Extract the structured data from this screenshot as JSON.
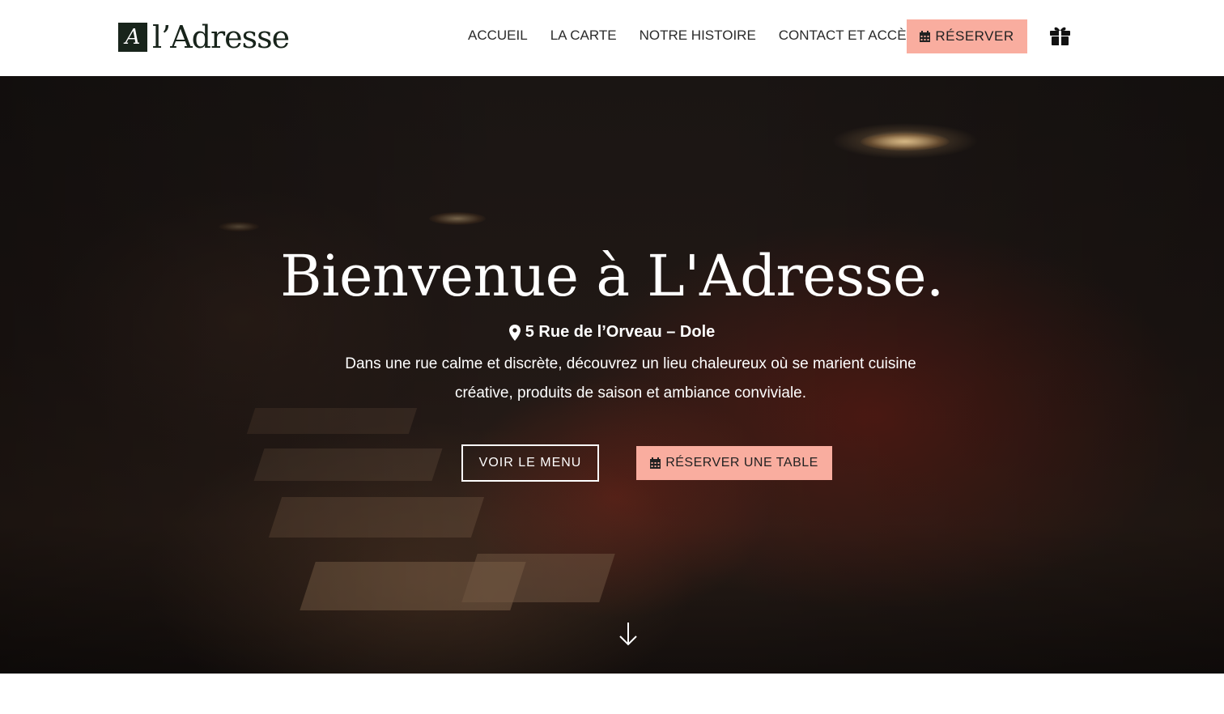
{
  "header": {
    "logo_mark": "A",
    "logo_text": "l’Adresse",
    "nav": [
      {
        "label": "ACCUEIL"
      },
      {
        "label": "LA CARTE"
      },
      {
        "label": "NOTRE HISTOIRE"
      },
      {
        "label": "CONTACT ET ACCÈS"
      }
    ],
    "reserve_label": "RÉSERVER",
    "reserve_icon": "calendar-icon",
    "gift_icon": "gift-icon"
  },
  "hero": {
    "title": "Bienvenue à L'Adresse.",
    "address": "5 Rue de l’Orveau – Dole",
    "address_icon": "map-pin-icon",
    "description": "Dans une rue calme et discrète, découvrez un lieu chaleureux où se marient cuisine créative, produits de saison et ambiance conviviale.",
    "menu_button": "VOIR LE MENU",
    "table_button": "RÉSERVER UNE TABLE",
    "scroll_icon": "arrow-down-icon"
  },
  "colors": {
    "accent": "#f9ad9f",
    "logo": "#18241b",
    "hero_text": "#ffffff"
  }
}
